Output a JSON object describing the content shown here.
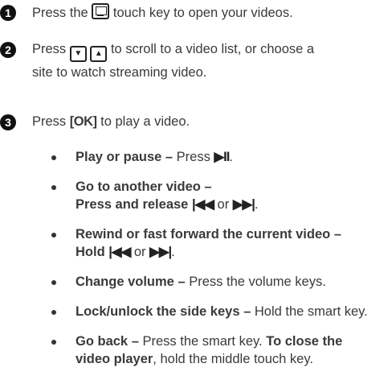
{
  "steps": [
    {
      "num": "1",
      "before": "Press the",
      "after": "touch key to open your videos."
    },
    {
      "num": "2",
      "before": "Press",
      "after": "to scroll to a video list, or choose a",
      "line2": "site to watch streaming video.",
      "down_glyph": "▼",
      "up_glyph": "▲"
    },
    {
      "num": "3",
      "before": "Press",
      "key": "[OK]",
      "after": "to play a video."
    }
  ],
  "glyphs": {
    "play_pause": "▶II",
    "prev": "|◀◀",
    "next": "▶▶|"
  },
  "bullets": [
    {
      "title": "Play or pause –",
      "text": "Press",
      "end": "."
    },
    {
      "title": "Go to another video –",
      "line2_bold": "Press and release",
      "or": "or",
      "end": "."
    },
    {
      "title": "Rewind or fast forward the current video –",
      "line2_bold": "Hold",
      "or": "or",
      "end": "."
    },
    {
      "title": "Change volume –",
      "text": "Press the volume keys."
    },
    {
      "title": "Lock/unlock the side keys –",
      "text": "Hold the smart key."
    },
    {
      "title": "Go back –",
      "text": "Press the smart key.",
      "bold_tail": "To close the",
      "line2_bold": "video player",
      "line2_text": ", hold the middle touch key."
    }
  ]
}
